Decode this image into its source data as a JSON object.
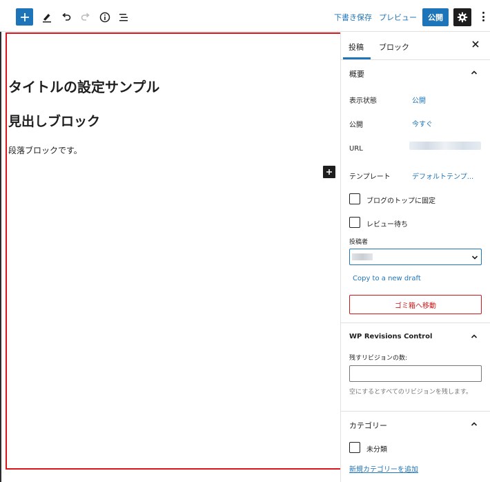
{
  "toolbar": {
    "save_draft": "下書き保存",
    "preview": "プレビュー",
    "publish": "公開"
  },
  "editor": {
    "post_title": "タイトルの設定サンプル",
    "heading_block": "見出しブロック",
    "paragraph_block": "段落ブロックです。"
  },
  "sidebar": {
    "tabs": [
      {
        "label": "投稿"
      },
      {
        "label": "ブロック"
      }
    ],
    "summary": {
      "title": "概要",
      "visibility_label": "表示状態",
      "visibility_value": "公開",
      "publish_label": "公開",
      "publish_value": "今すぐ",
      "url_label": "URL",
      "template_label": "テンプレート",
      "template_value": "デフォルトテンプ...",
      "sticky_label": "ブログのトップに固定",
      "pending_label": "レビュー待ち",
      "author_label": "投稿者",
      "copy_draft": "Copy to a new draft",
      "trash": "ゴミ箱へ移動"
    },
    "revisions": {
      "title": "WP Revisions Control",
      "keep_label": "残すリビジョンの数:",
      "input_value": "",
      "help": "空にするとすべてのリビジョンを残します。"
    },
    "categories": {
      "title": "カテゴリー",
      "items": [
        {
          "label": "未分類"
        }
      ],
      "add_new": "新規カテゴリーを追加"
    }
  },
  "colors": {
    "accent": "#1e74b8",
    "highlight_border": "#d9151c",
    "danger": "#cc1818",
    "dark": "#1e1e1e"
  }
}
